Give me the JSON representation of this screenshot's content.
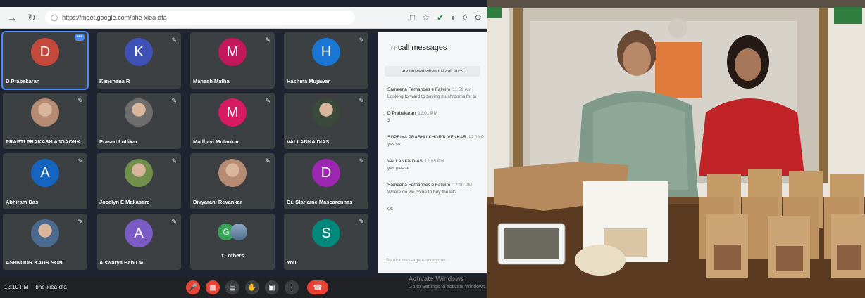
{
  "browser": {
    "url": "https://meet.google.com/bhe-xiea-dfa"
  },
  "tiles": [
    {
      "name": "D Prabakaran",
      "initial": "D",
      "color": "#c5493a",
      "kind": "avatar",
      "speaking": true
    },
    {
      "name": "Kanchana R",
      "initial": "K",
      "color": "#3f51b5",
      "kind": "avatar"
    },
    {
      "name": "Mahesh Matha",
      "initial": "M",
      "color": "#c2185b",
      "kind": "avatar"
    },
    {
      "name": "Hashma Mujawar",
      "initial": "H",
      "color": "#1976d2",
      "kind": "avatar"
    },
    {
      "name": "PRAPTI PRAKASH AJGAONK...",
      "kind": "photo"
    },
    {
      "name": "Prasad Lotlikar",
      "kind": "photo"
    },
    {
      "name": "Madhavi Motankar",
      "initial": "M",
      "color": "#d81b60",
      "kind": "avatar"
    },
    {
      "name": "VALLANKA DIAS",
      "kind": "photo"
    },
    {
      "name": "Abhiram Das",
      "initial": "A",
      "color": "#1565c0",
      "kind": "avatar"
    },
    {
      "name": "Jocelyn E Makasare",
      "kind": "photo"
    },
    {
      "name": "Divyarani Revankar",
      "kind": "photo"
    },
    {
      "name": "Dr. Starlaine Mascarenhas",
      "initial": "D",
      "color": "#9c27b0",
      "kind": "avatar"
    },
    {
      "name": "ASHNOOR KAUR SONI",
      "kind": "photo"
    },
    {
      "name": "Aiswarya Babu M",
      "initial": "A",
      "color": "#7b5cc4",
      "kind": "avatar"
    },
    {
      "name": "11 others",
      "initial": "G",
      "color": "#3aa35a",
      "kind": "others"
    },
    {
      "name": "You",
      "initial": "S",
      "color": "#00897b",
      "kind": "avatar"
    }
  ],
  "chat": {
    "title": "In-call messages",
    "notice": "are deleted when the call ends",
    "messages": [
      {
        "sender": "Sameena Fernandes e Falleiro",
        "time": "11:59 AM",
        "text": "Looking forward to having mushrooms for lu"
      },
      {
        "sender": "D Prabakaran",
        "time": "12:01 PM",
        "text": "3"
      },
      {
        "sender": "SUPRIYA PRABHU KHORJUVENKAR",
        "time": "12:03 P",
        "text": "yes sir"
      },
      {
        "sender": "VALLANKA DIAS",
        "time": "12:05 PM",
        "text": "yes please"
      },
      {
        "sender": "Sameena Fernandes e Falleiro",
        "time": "12:10 PM",
        "text": "Where do we come to buy the kit?"
      },
      {
        "sender": "",
        "time": "",
        "text": "Ok"
      }
    ],
    "input_placeholder": "Send a message to everyone"
  },
  "bottom": {
    "time": "12:10 PM",
    "meeting_code": "bhe-xiea-dfa"
  },
  "watermark": {
    "line1": "Activate Windows",
    "line2": "Go to Settings to activate Windows."
  },
  "icons": [
    "back-arrow-icon",
    "reload-icon",
    "lock-icon",
    "tab-icon",
    "star-icon",
    "check-icon",
    "mic-off-icon",
    "camera-off-icon",
    "captions-icon",
    "hand-icon",
    "present-icon",
    "more-icon",
    "end-call-icon"
  ]
}
